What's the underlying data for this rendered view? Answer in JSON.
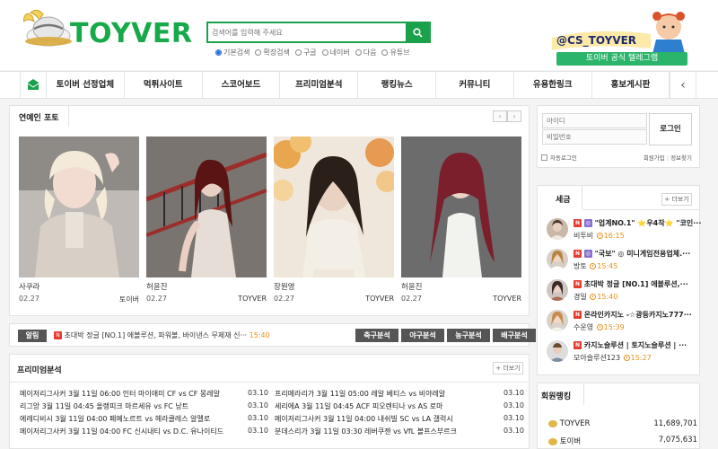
{
  "site": {
    "logo_text": "TOYVER",
    "search_placeholder": "검색어를 입력해 주세요",
    "search_options": [
      {
        "label": "기본검색",
        "selected": true
      },
      {
        "label": "확장검색",
        "selected": false
      },
      {
        "label": "구글",
        "selected": false
      },
      {
        "label": "네이버",
        "selected": false
      },
      {
        "label": "다음",
        "selected": false
      },
      {
        "label": "유튜브",
        "selected": false
      }
    ],
    "banner_handle": "@CS_TOYVER",
    "banner_button": "토이버 공식 텔레그램"
  },
  "nav": {
    "items": [
      "토이버 선정업체",
      "먹튀사이트",
      "스코어보드",
      "프리미엄분석",
      "랭킹뉴스",
      "커뮤니티",
      "유용한링크",
      "홍보게시판"
    ],
    "prev": "‹"
  },
  "photo_panel": {
    "title": "연예인 포토",
    "pager_prev": "‹",
    "pager_next": "›",
    "photos": [
      {
        "name": "사쿠라",
        "date": "02.27",
        "source": "토이버"
      },
      {
        "name": "허윤진",
        "date": "02.27",
        "source": "TOYVER"
      },
      {
        "name": "장원영",
        "date": "02.27",
        "source": "TOYVER"
      },
      {
        "name": "허윤진",
        "date": "02.27",
        "source": "TOYVER"
      }
    ]
  },
  "alert": {
    "label": "알림",
    "hot": "N",
    "text": "초대박 정글 [NO.1] 에볼루션, 파워볼, 바이낸스 무제재 신···",
    "time": "15:40",
    "buttons": [
      "축구분석",
      "야구분석",
      "농구분석",
      "배구분석"
    ]
  },
  "premium": {
    "title": "프리미엄분석",
    "more": "+ 더보기",
    "left": [
      {
        "text": "메이저리그사커 3월 11일 06:00 인터 마이애미 CF vs CF 몽레알",
        "date": "03.10"
      },
      {
        "text": "리그앙 3월 11일 04:45 올랭피크 마르세유 vs FC 낭트",
        "date": "03.10"
      },
      {
        "text": "에레디비시 3월 11일 04:00 페예노르트 vs 헤라클레스 알멜로",
        "date": "03.10"
      },
      {
        "text": "메이저리그사커 3월 11일 04:00 FC 신시내티 vs D.C. 유나이티드",
        "date": "03.10"
      }
    ],
    "right": [
      {
        "text": "프리메라리가 3월 11일 05:00 레알 베티스 vs 비야레알",
        "date": "03.10"
      },
      {
        "text": "세리에A 3월 11일 04:45 ACF 피오렌티나 vs AS 로마",
        "date": "03.10"
      },
      {
        "text": "메이저리그사커 3월 11일 04:00 내쉬빌 SC vs LA 갤럭시",
        "date": "03.10"
      },
      {
        "text": "분데스리가 3월 11일 03:30 레버쿠젠 vs VfL 볼프스부르크",
        "date": "03.10"
      }
    ]
  },
  "login": {
    "id_placeholder": "아이디",
    "pw_placeholder": "비밀번호",
    "button": "로그인",
    "auto_login": "자동로그인",
    "join": "회원가입",
    "find": "정보찾기"
  },
  "tax": {
    "title": "세금",
    "more": "+ 더보기",
    "items": [
      {
        "line1": "\"업계NO.1\" ⭐우4작⭐ \"코인···",
        "user": "비투비",
        "time": "16:15",
        "badge": "◎"
      },
      {
        "line1": "\"국보\" ◎ 미니게임전용업체.···",
        "user": "방토",
        "time": "15:45",
        "badge": "◎"
      },
      {
        "line1": "초대박 정글 [NO.1] 에볼루션,···",
        "user": "경일",
        "time": "15:40",
        "badge": ""
      },
      {
        "line1": "온라인카지노 -☆광등카지노777···",
        "user": "수운영",
        "time": "15:39",
        "badge": ""
      },
      {
        "line1": "카지노슬루션 | 토지노슬루션 | ···",
        "user": "모아슬루션123",
        "time": "15:27",
        "badge": ""
      }
    ]
  },
  "ranking": {
    "title": "회원랭킹",
    "rows": [
      {
        "name": "TOYVER",
        "points": "11,689,701"
      },
      {
        "name": "토이버",
        "points": "7,075,631"
      }
    ]
  },
  "colors": {
    "brand_green": "#1aa14b",
    "hot_red": "#e63b2e",
    "time_orange": "#e88f1a"
  }
}
